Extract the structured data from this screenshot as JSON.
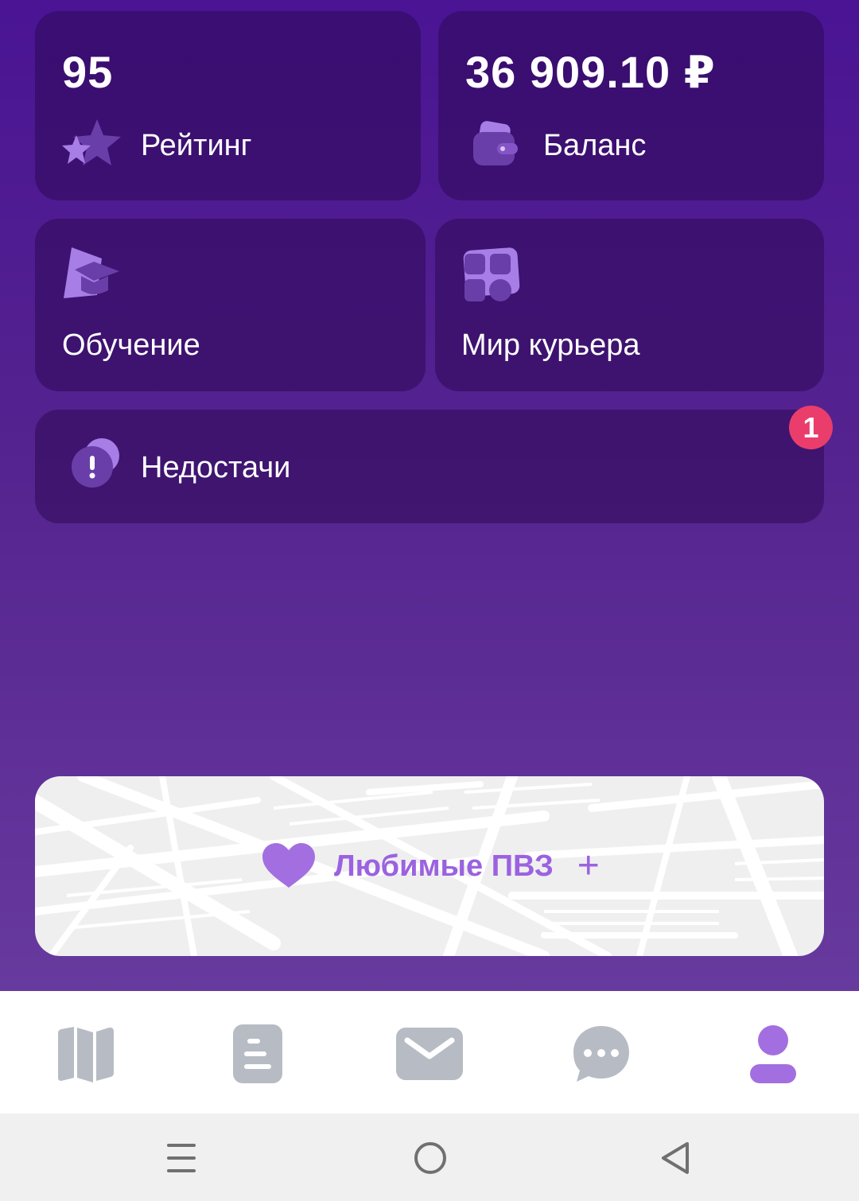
{
  "rating": {
    "value": "95",
    "label": "Рейтинг"
  },
  "balance": {
    "value": "36 909.10 ₽",
    "label": "Баланс"
  },
  "learning": {
    "label": "Обучение"
  },
  "courier_world": {
    "label": "Мир курьера"
  },
  "shortages": {
    "label": "Недостачи",
    "badge": "1"
  },
  "favorites": {
    "label": "Любимые ПВЗ",
    "plus": "+"
  },
  "tabbar": {
    "items": [
      {
        "icon": "map-icon",
        "active": false
      },
      {
        "icon": "orders-icon",
        "active": false
      },
      {
        "icon": "mail-icon",
        "active": false
      },
      {
        "icon": "chat-icon",
        "active": false
      },
      {
        "icon": "profile-icon",
        "active": true
      }
    ]
  },
  "colors": {
    "accent": "#9b62e0",
    "badge": "#ea3d6b",
    "inactive_tab": "#b7bcc4"
  }
}
